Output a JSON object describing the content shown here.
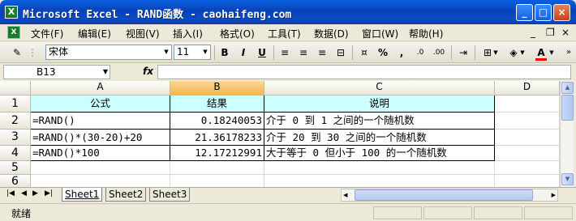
{
  "window": {
    "title": "Microsoft Excel - RAND函数 - caohaifeng.com",
    "minimize": "_",
    "maximize": "□",
    "close": "×"
  },
  "menubar": {
    "items": [
      "文件(F)",
      "编辑(E)",
      "视图(V)",
      "插入(I)",
      "格式(O)",
      "工具(T)",
      "数据(D)",
      "窗口(W)",
      "帮助(H)"
    ],
    "mdi_minimize": "_",
    "mdi_restore": "❐",
    "mdi_close": "×"
  },
  "toolbar": {
    "font_name": "宋体",
    "font_size": "11",
    "bold": "B",
    "italic": "I",
    "underline": "U",
    "percent": "%",
    "comma": ",",
    "font_color_letter": "A",
    "font_color": "#FF0000",
    "fill_color": "#FFFF00"
  },
  "formula_bar": {
    "name_box": "B13",
    "fx": "fx",
    "formula": ""
  },
  "grid": {
    "columns": [
      "A",
      "B",
      "C",
      "D"
    ],
    "active_column": "B",
    "rows": [
      "1",
      "2",
      "3",
      "4",
      "5",
      "6"
    ],
    "header_fill": "#CCFFFF",
    "cells": {
      "A1": "公式",
      "B1": "结果",
      "C1": "说明",
      "A2": "=RAND()",
      "B2": "0.18240053",
      "C2": "介于 0 到 1 之间的一个随机数",
      "A3": "=RAND()*(30-20)+20",
      "B3": "21.36178233",
      "C3": "介于 20 到 30 之间的一个随机数",
      "A4": "=RAND()*100",
      "B4": "12.17212991",
      "C4": "大于等于 0 但小于 100 的一个随机数"
    }
  },
  "sheets": {
    "tabs": [
      "Sheet1",
      "Sheet2",
      "Sheet3"
    ],
    "active": "Sheet1"
  },
  "status": {
    "text": "就绪"
  }
}
